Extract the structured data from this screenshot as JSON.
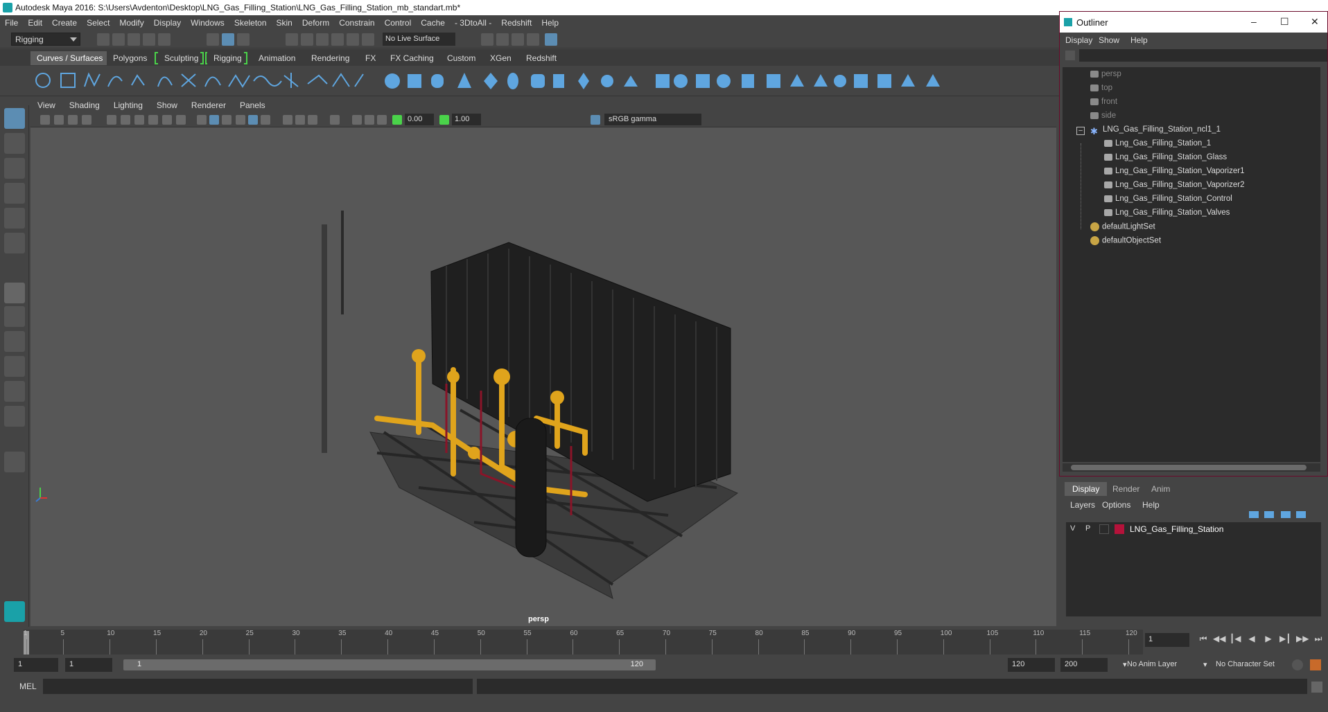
{
  "window": {
    "title": "Autodesk Maya 2016: S:\\Users\\Avdenton\\Desktop\\LNG_Gas_Filling_Station\\LNG_Gas_Filling_Station_mb_standart.mb*"
  },
  "menubar": [
    "File",
    "Edit",
    "Create",
    "Select",
    "Modify",
    "Display",
    "Windows",
    "Skeleton",
    "Skin",
    "Deform",
    "Constrain",
    "Control",
    "Cache",
    "- 3DtoAll -",
    "Redshift",
    "Help"
  ],
  "statusline": {
    "mode": "Rigging",
    "live_surface": "No Live Surface"
  },
  "shelf_tabs": [
    "Curves / Surfaces",
    "Polygons",
    "Sculpting",
    "Rigging",
    "Animation",
    "Rendering",
    "FX",
    "FX Caching",
    "Custom",
    "XGen",
    "Redshift"
  ],
  "panel_menu": [
    "View",
    "Shading",
    "Lighting",
    "Show",
    "Renderer",
    "Panels"
  ],
  "panel_tools": {
    "value_a": "0.00",
    "value_b": "1.00",
    "color_space": "sRGB gamma"
  },
  "viewport": {
    "camera_label": "persp"
  },
  "outliner": {
    "title": "Outliner",
    "menu": [
      "Display",
      "Show",
      "Help"
    ],
    "items": [
      {
        "label": "persp",
        "kind": "camera",
        "indent": 0,
        "dim": true
      },
      {
        "label": "top",
        "kind": "camera",
        "indent": 0,
        "dim": true
      },
      {
        "label": "front",
        "kind": "camera",
        "indent": 0,
        "dim": true
      },
      {
        "label": "side",
        "kind": "camera",
        "indent": 0,
        "dim": true
      },
      {
        "label": "LNG_Gas_Filling_Station_ncl1_1",
        "kind": "group",
        "indent": 0,
        "dim": false
      },
      {
        "label": "Lng_Gas_Filling_Station_1",
        "kind": "mesh",
        "indent": 1,
        "dim": false
      },
      {
        "label": "Lng_Gas_Filling_Station_Glass",
        "kind": "mesh",
        "indent": 1,
        "dim": false
      },
      {
        "label": "Lng_Gas_Filling_Station_Vaporizer1",
        "kind": "mesh",
        "indent": 1,
        "dim": false
      },
      {
        "label": "Lng_Gas_Filling_Station_Vaporizer2",
        "kind": "mesh",
        "indent": 1,
        "dim": false
      },
      {
        "label": "Lng_Gas_Filling_Station_Control",
        "kind": "mesh",
        "indent": 1,
        "dim": false
      },
      {
        "label": "Lng_Gas_Filling_Station_Valves",
        "kind": "mesh",
        "indent": 1,
        "dim": false
      },
      {
        "label": "defaultLightSet",
        "kind": "set",
        "indent": 0,
        "dim": false
      },
      {
        "label": "defaultObjectSet",
        "kind": "set",
        "indent": 0,
        "dim": false
      }
    ]
  },
  "layers": {
    "tabs": [
      "Display",
      "Render",
      "Anim"
    ],
    "menu": [
      "Layers",
      "Options",
      "Help"
    ],
    "rows": [
      {
        "v": "V",
        "p": "P",
        "name": "LNG_Gas_Filling_Station",
        "color": "#b5123a"
      }
    ]
  },
  "timeline": {
    "ticks": [
      "1",
      "5",
      "10",
      "15",
      "20",
      "25",
      "30",
      "35",
      "40",
      "45",
      "50",
      "55",
      "60",
      "65",
      "70",
      "75",
      "80",
      "85",
      "90",
      "95",
      "100",
      "105",
      "110",
      "115",
      "120"
    ],
    "current_frame": "1"
  },
  "range": {
    "start": "1",
    "anim_start": "1",
    "slider_start": "1",
    "slider_end": "120",
    "end": "120",
    "anim_end": "200",
    "anim_layer": "No Anim Layer",
    "character_set": "No Character Set"
  },
  "cmd": {
    "label": "MEL"
  }
}
